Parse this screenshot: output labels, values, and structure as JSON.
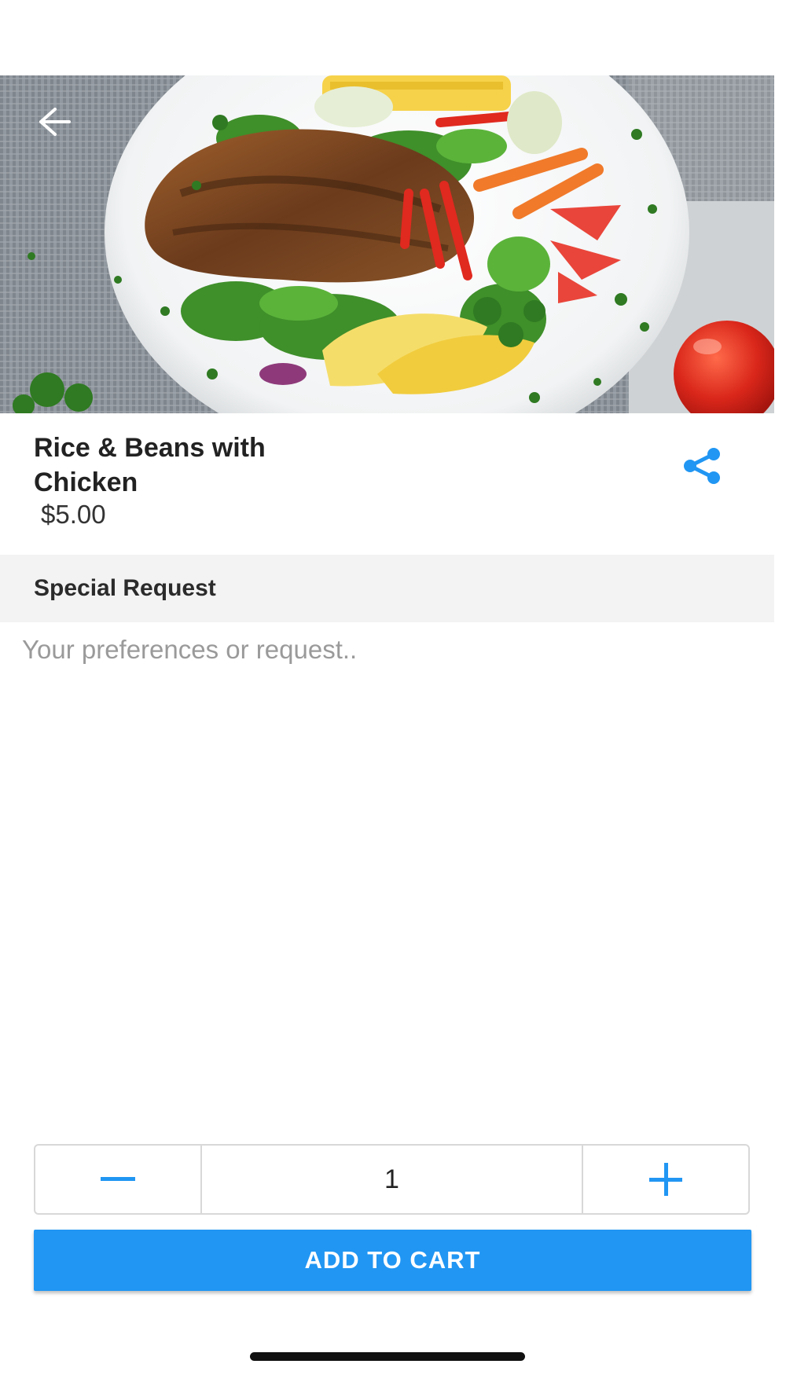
{
  "item": {
    "title": "Rice & Beans with Chicken",
    "price": "$5.00",
    "image_icon": "food-photo"
  },
  "special_request": {
    "title": "Special Request",
    "placeholder": "Your preferences or request.."
  },
  "quantity": {
    "value": "1",
    "decrement_icon": "minus-icon",
    "increment_icon": "plus-icon"
  },
  "actions": {
    "add_to_cart_label": "ADD TO CART"
  },
  "colors": {
    "accent": "#2196f3",
    "section_bg": "#f3f3f3",
    "placeholder": "#9a9a9a"
  }
}
